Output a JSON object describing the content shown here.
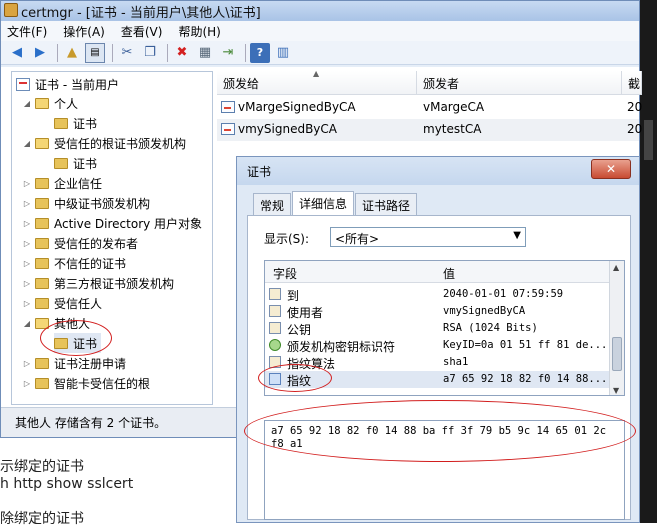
{
  "window": {
    "title": "certmgr - [证书 - 当前用户\\其他人\\证书]"
  },
  "menu": [
    "文件(F)",
    "操作(A)",
    "查看(V)",
    "帮助(H)"
  ],
  "tree": {
    "root": "证书 - 当前用户",
    "items": [
      {
        "label": "个人",
        "level": 1,
        "expanded": true
      },
      {
        "label": "证书",
        "level": 2
      },
      {
        "label": "受信任的根证书颁发机构",
        "level": 1,
        "expanded": true
      },
      {
        "label": "证书",
        "level": 2
      },
      {
        "label": "企业信任",
        "level": 1
      },
      {
        "label": "中级证书颁发机构",
        "level": 1
      },
      {
        "label": "Active Directory 用户对象",
        "level": 1
      },
      {
        "label": "受信任的发布者",
        "level": 1
      },
      {
        "label": "不信任的证书",
        "level": 1
      },
      {
        "label": "第三方根证书颁发机构",
        "level": 1
      },
      {
        "label": "受信任人",
        "level": 1
      },
      {
        "label": "其他人",
        "level": 1,
        "expanded": true
      },
      {
        "label": "证书",
        "level": 2,
        "selected": true
      },
      {
        "label": "证书注册申请",
        "level": 1
      },
      {
        "label": "智能卡受信任的根",
        "level": 1
      }
    ]
  },
  "list": {
    "columns": [
      "颁发给",
      "颁发者",
      "截"
    ],
    "rows": [
      {
        "issued_to": "vMargeSignedByCA",
        "issued_by": "vMargeCA",
        "date": "20"
      },
      {
        "issued_to": "vmySignedByCA",
        "issued_by": "mytestCA",
        "date": "20"
      }
    ]
  },
  "status": "其他人 存储含有 2 个证书。",
  "background_lines": [
    "示绑定的证书",
    "h http show sslcert",
    "除绑定的证书"
  ],
  "dialog": {
    "title": "证书",
    "close": "✕",
    "tabs": [
      "常规",
      "详细信息",
      "证书路径"
    ],
    "show_label": "显示(S):",
    "show_value": "<所有>",
    "fields_header": {
      "field": "字段",
      "value": "值"
    },
    "fields": [
      {
        "name": "到",
        "value": "2040-01-01 07:59:59",
        "icon": "field-doc-icon"
      },
      {
        "name": "使用者",
        "value": "vmySignedByCA",
        "icon": "field-doc-icon"
      },
      {
        "name": "公钥",
        "value": "RSA (1024 Bits)",
        "icon": "field-doc-icon"
      },
      {
        "name": "颁发机构密钥标识符",
        "value": "KeyID=0a 01 51 ff 81 de...",
        "icon": "field-ext-icon"
      },
      {
        "name": "指纹算法",
        "value": "sha1",
        "icon": "field-doc-icon"
      },
      {
        "name": "指纹",
        "value": "a7 65 92 18 82 f0 14 88...",
        "icon": "field-prop-icon",
        "selected": true
      }
    ],
    "value_text": "a7 65 92 18 82 f0 14 88 ba ff 3f 79 b5 9c 14 65 01 2c f8 a1"
  },
  "colors": {
    "annotation": "#d21e1e",
    "selection": "#dfe7f3"
  }
}
